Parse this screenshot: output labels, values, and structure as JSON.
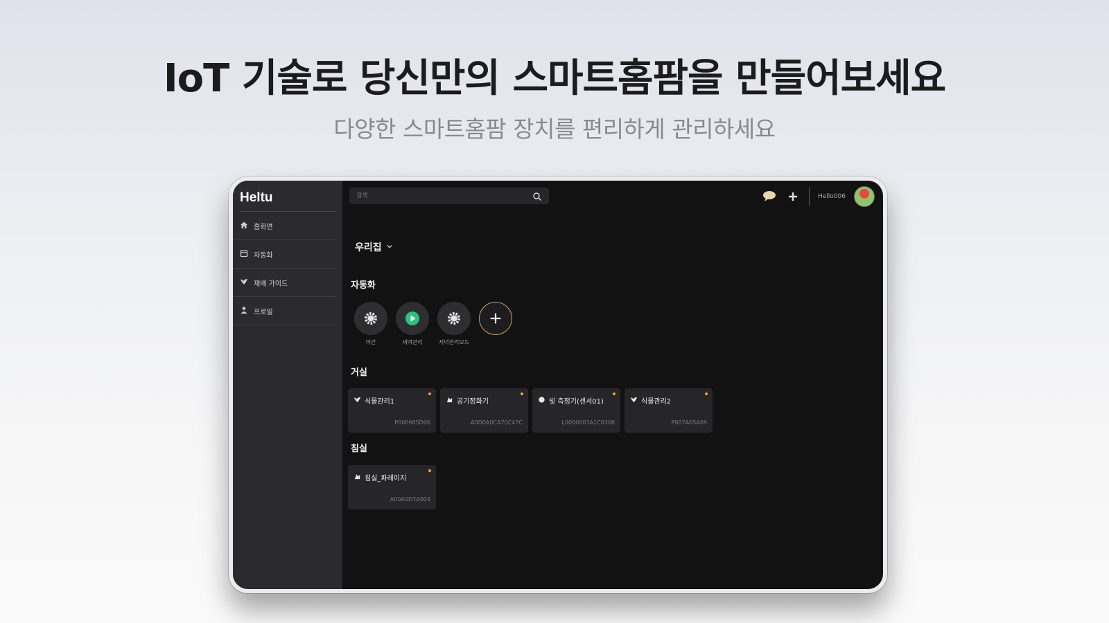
{
  "promo": {
    "headline": "IoT 기술로 당신만의 스마트홈팜을 만들어보세요",
    "subline": "다양한 스마트홈팜 장치를 편리하게 관리하세요"
  },
  "app": {
    "logo": "Heltu",
    "nav": [
      {
        "label": "홈화면",
        "icon": "home-icon"
      },
      {
        "label": "자동화",
        "icon": "calendar-icon"
      },
      {
        "label": "재배 가이드",
        "icon": "leaf-icon"
      },
      {
        "label": "프로필",
        "icon": "user-icon"
      }
    ],
    "search": {
      "placeholder": "검색"
    },
    "user": {
      "name": "Hello006"
    },
    "home_selector": "우리집",
    "automation_section": "자동화",
    "automations": [
      {
        "label": "야간",
        "icon": "gear-icon"
      },
      {
        "label": "새벽관리",
        "icon": "play-icon"
      },
      {
        "label": "저녁관리모드",
        "icon": "gear-icon"
      },
      {
        "label": "",
        "icon": "plus-icon"
      }
    ],
    "rooms": [
      {
        "name": "거실",
        "devices": [
          {
            "name": "식물관리1",
            "code": "P000985D06",
            "icon": "leaf-icon"
          },
          {
            "name": "공기정화기",
            "code": "A0D0A0CA70C47C",
            "icon": "fan-icon"
          },
          {
            "name": "빛 측정기(센서01)",
            "code": "L0000003A1C0308",
            "icon": "sensor-icon"
          },
          {
            "name": "식물관리2",
            "code": "P007A65A09",
            "icon": "leaf-icon"
          }
        ]
      },
      {
        "name": "침실",
        "devices": [
          {
            "name": "침실_파레이지",
            "code": "A00A0D7A004",
            "icon": "fan-icon"
          }
        ]
      }
    ],
    "colors": {
      "accent": "#f0a330",
      "play": "#2ec27e",
      "add_border": "#c9a464"
    }
  }
}
